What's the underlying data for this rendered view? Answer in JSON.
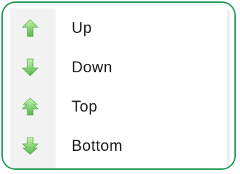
{
  "context_menu": {
    "items": [
      {
        "label": "Up",
        "icon": "arrow-up-icon"
      },
      {
        "label": "Down",
        "icon": "arrow-down-icon"
      },
      {
        "label": "Top",
        "icon": "arrow-to-top-icon"
      },
      {
        "label": "Bottom",
        "icon": "arrow-to-bottom-icon"
      }
    ]
  },
  "colors": {
    "frame_border": "#1f9a4e",
    "icon_light": "#b9ec9b",
    "icon_dark": "#5dbf4d",
    "gutter": "#f1f2f1",
    "text": "#1c1c1c"
  }
}
